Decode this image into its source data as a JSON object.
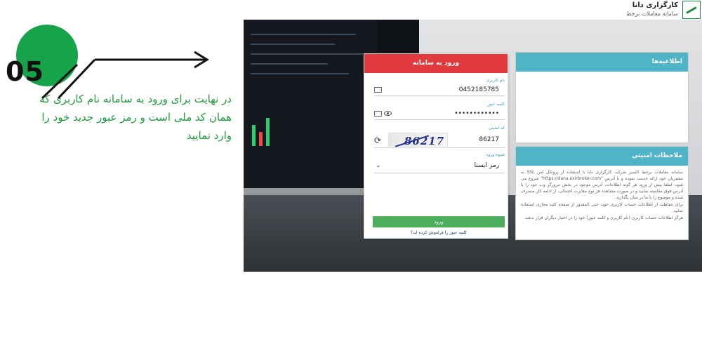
{
  "tutorial": {
    "step_number": "05",
    "caption": "در نهایت برای ورود به سامانه  نام کاربری که همان کد ملی است و رمز عبور جدید خود را وارد نمایید"
  },
  "brand": {
    "name": "کارگزاری دانا",
    "subtitle": "سامانه معاملات برخط"
  },
  "login": {
    "title": "ورود به سامانه",
    "username_label": "نام کاربری",
    "username_value": "0452185785",
    "password_label": "کلمه عبور",
    "password_value": "••••••••••••",
    "captcha_label": "کد امنیتی",
    "captcha_value": "86217",
    "captcha_image_text": "86217",
    "method_label": "شیوه ورود",
    "method_value": "رمز ایستا",
    "submit_label": "ورود",
    "forgot_label": "کلمه عبور را فراموش کرده اید؟"
  },
  "news": {
    "title": "اطلاعیه‌ها"
  },
  "security": {
    "title": "ملاحظات امنیتی",
    "paragraphs": [
      "سامانه معاملات برخط اکسیر شرکت کارگزاری دانا با استفاده از پروتکل امن SSL به مشتریان خود ارائه خدمت نموده و با آدرس \"https://dana.exirbroker.com\" شروع می شود. لطفا پیش از ورود هر گونه اطلاعات، آدرس موجود در بخش مرورگر وب خود را با آدرس فوق مقایسه نمایید و در صورت مشاهده هر نوع مغایرت احتمالی، از ادامه کار منصرف شده و موضوع را با ما در میان بگذارید.",
      "برای حفاظت از اطلاعات حساب کاربری خود، حتی المقدور از صفحه کلید مجازی استفاده نمایید.",
      "هرگز اطلاعات حساب کاربری (نام کاربری و کلمه عبور) خود را در اختیار دیگران قرار ندهید."
    ]
  },
  "colors": {
    "accent_green": "#17a34a",
    "login_header": "#e23b3f",
    "panel_header": "#4fb5c6",
    "login_button": "#4cae5c"
  }
}
